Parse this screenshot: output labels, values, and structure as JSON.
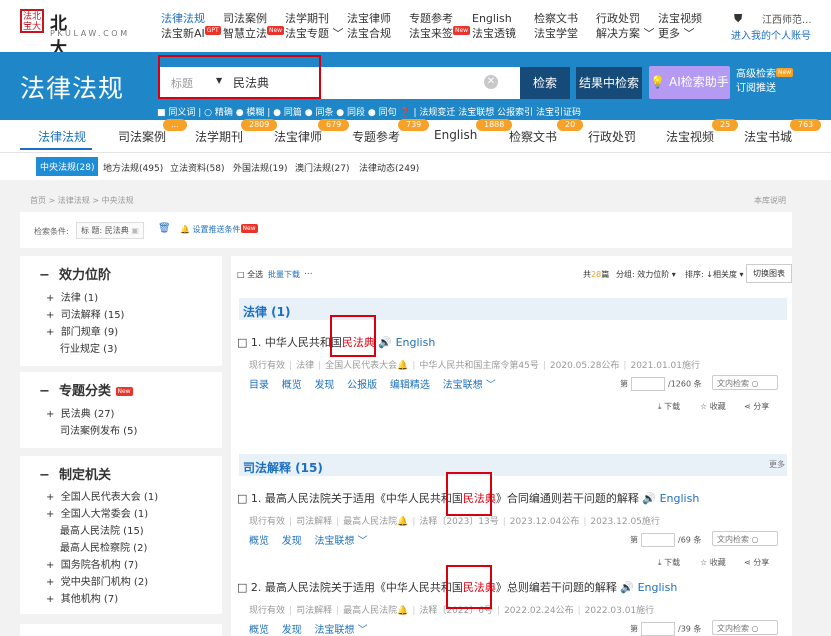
{
  "logo": {
    "seal_text": "法北宝大",
    "name": "北大法宝",
    "domain": "PKULAW.COM"
  },
  "topnav": [
    {
      "line1": "法律法规",
      "line2": "法宝新AI",
      "badge": "GPT",
      "active": true
    },
    {
      "line1": "司法案例",
      "line2": "智慧立法",
      "badge": "New"
    },
    {
      "line1": "法学期刊",
      "line2": "法宝专题 ﹀"
    },
    {
      "line1": "法宝律师",
      "line2": "法宝合规"
    },
    {
      "line1": "专题参考",
      "line2": "法宝来签",
      "badge": "New"
    },
    {
      "line1": "English",
      "line2": "法宝透镜"
    },
    {
      "line1": "检察文书",
      "line2": "法宝学堂"
    },
    {
      "line1": "行政处罚",
      "line2": "解决方案 ﹀"
    },
    {
      "line1": "法宝视频",
      "line2": "更多 ﹀"
    }
  ],
  "user": {
    "name": "江西师范...",
    "link": "进入我的个人账号"
  },
  "hero": {
    "title": "法律法规"
  },
  "search": {
    "field": "标题",
    "caret": "▼",
    "value": "民法典",
    "clear": "✕",
    "search_btn": "检索",
    "result_btn": "结果中检索",
    "ai_btn": "AI检索助手",
    "advanced": "高级检索",
    "subscribe": "订阅推送",
    "new_badge": "New"
  },
  "options": {
    "text": "■ 同义词  |  ○ 精确 ● 模糊 | ● 同篇 ● 同条 ● 同段 ● 同句  ❓ | 法规变迁  法宝联想  公报索引  法宝引证码"
  },
  "tabs": [
    {
      "label": "法律法规",
      "active": true
    },
    {
      "label": "司法案例",
      "count": "..."
    },
    {
      "label": "法学期刊",
      "count": "2809"
    },
    {
      "label": "法宝律师",
      "count": "679"
    },
    {
      "label": "专题参考",
      "count": "739"
    },
    {
      "label": "English",
      "count": "1888"
    },
    {
      "label": "检察文书",
      "count": "20"
    },
    {
      "label": "行政处罚"
    },
    {
      "label": "法宝视频",
      "count": "25"
    },
    {
      "label": "法宝书城",
      "count": "763"
    }
  ],
  "subtabs": [
    "中央法规(28)",
    "地方法规(495)",
    "立法资料(58)",
    "外国法规(19)",
    "澳门法规(27)",
    "法律动态(249)"
  ],
  "crumb": {
    "path": "首页 > 法律法规 > 中央法规",
    "right": "本库说明"
  },
  "filter": {
    "label": "检索条件:",
    "tag": "标 题: 民法典",
    "set_push": "设置推送条件",
    "new_badge": "New"
  },
  "sidebar": {
    "effect": {
      "title": "效力位阶",
      "items": [
        "法律 (1)",
        "司法解释 (15)",
        "部门规章 (9)",
        "行业规定 (3)"
      ]
    },
    "topic": {
      "title": "专题分类",
      "badge": "New",
      "items": [
        "民法典 (27)",
        "司法案例发布 (5)"
      ]
    },
    "org": {
      "title": "制定机关",
      "items": [
        "全国人民代表大会 (1)",
        "全国人大常委会 (1)",
        "最高人民法院 (15)",
        "最高人民检察院 (2)",
        "国务院各机构 (7)",
        "党中央部门机构 (2)",
        "其他机构 (7)"
      ]
    }
  },
  "toolbar": {
    "select_all": "□ 全选",
    "batch": "批量下载",
    "more": "...",
    "total_pre": "共",
    "total": "28",
    "total_suf": "篇",
    "group": "分组: 效力位阶 ▾",
    "sort": "排序: ↓相关度 ▾",
    "switch": "切换图表"
  },
  "results": {
    "law": {
      "header": "法律 (1)",
      "item": {
        "title_pre": "□ 1. 中华人民共和国",
        "title_hl": "民法典",
        "audio": "🔊",
        "english": "English",
        "meta": [
          "现行有效",
          "法律",
          "全国人民代表大会🔔",
          "中华人民共和国主席令第45号",
          "2020.05.28公布",
          "2021.01.01施行"
        ],
        "actions": [
          "目录",
          "概览",
          "发现",
          "公报版",
          "编辑精选",
          "法宝联想 ﹀"
        ],
        "page_pre": "第",
        "page_suf": "/1260 条",
        "doc_search": "文内检索",
        "download": "⤓ 下载",
        "fav": "☆ 收藏",
        "share": "⋖ 分享"
      }
    },
    "interp": {
      "header": "司法解释 (15)",
      "more": "更多",
      "items": [
        {
          "title_pre": "□ 1. 最高人民法院关于适用《中华人民共和国",
          "title_hl": "民法典",
          "title_suf": "》合同编通则若干问题的解释",
          "audio": "🔊",
          "english": "English",
          "meta": [
            "现行有效",
            "司法解释",
            "最高人民法院🔔",
            "法释〔2023〕13号",
            "2023.12.04公布",
            "2023.12.05施行"
          ],
          "actions": [
            "概览",
            "发现",
            "法宝联想 ﹀"
          ],
          "page_suf": "/69 条",
          "doc_search": "文内检索",
          "download": "⤓ 下载",
          "fav": "☆ 收藏",
          "share": "⋖ 分享"
        },
        {
          "title_pre": "□ 2. 最高人民法院关于适用《中华人民共和国",
          "title_hl": "民法典",
          "title_suf": "》总则编若干问题的解释",
          "audio": "🔊",
          "english": "English",
          "meta": [
            "现行有效",
            "司法解释",
            "最高人民法院🔔",
            "法释〔2022〕6号",
            "2022.02.24公布",
            "2022.03.01施行"
          ],
          "actions": [
            "概览",
            "发现",
            "法宝联想 ﹀"
          ],
          "page_suf": "/39 条",
          "doc_search": "文内检索"
        }
      ]
    }
  },
  "colors": {
    "hero": "#1f87c8",
    "accent": "#1e6fbf",
    "highlight": "#d7000f",
    "orange": "#f7a128"
  }
}
